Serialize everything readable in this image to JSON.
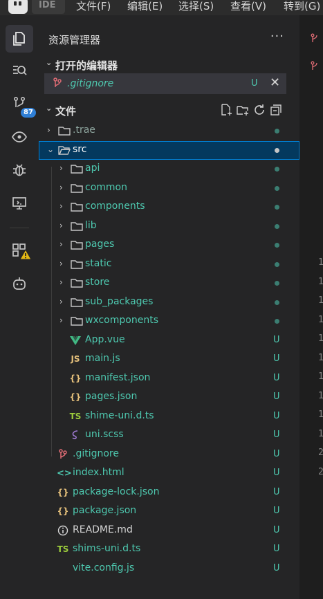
{
  "menubar": {
    "product": "IDE",
    "items": [
      "文件(F)",
      "编辑(E)",
      "选择(S)",
      "查看(V)",
      "转到(G)"
    ]
  },
  "activity_bar": {
    "items": [
      "explorer-icon",
      "search-icon",
      "source-control-icon",
      "preview-icon",
      "debug-icon",
      "remote-icon",
      "extensions-icon",
      "ai-assistant-icon"
    ],
    "source_control_badge": "87",
    "extensions_badge": "!"
  },
  "sidebar": {
    "title": "资源管理器",
    "more": "···",
    "open_editors": {
      "label": "打开的编辑器",
      "items": [
        {
          "name": ".gitignore",
          "status": "U",
          "close": "✕"
        }
      ]
    },
    "files": {
      "label": "文件"
    }
  },
  "tree": [
    {
      "name": ".trae",
      "type": "folder",
      "depth": 0,
      "expanded": false,
      "marker": "dot"
    },
    {
      "name": "src",
      "type": "folder",
      "depth": 0,
      "expanded": true,
      "marker": "dot",
      "selected": true
    },
    {
      "name": "api",
      "type": "folder",
      "depth": 1,
      "expanded": false,
      "marker": "dot"
    },
    {
      "name": "common",
      "type": "folder",
      "depth": 1,
      "expanded": false,
      "marker": "dot"
    },
    {
      "name": "components",
      "type": "folder",
      "depth": 1,
      "expanded": false,
      "marker": "dot"
    },
    {
      "name": "lib",
      "type": "folder",
      "depth": 1,
      "expanded": false,
      "marker": "dot"
    },
    {
      "name": "pages",
      "type": "folder",
      "depth": 1,
      "expanded": false,
      "marker": "dot"
    },
    {
      "name": "static",
      "type": "folder",
      "depth": 1,
      "expanded": false,
      "marker": "dot"
    },
    {
      "name": "store",
      "type": "folder",
      "depth": 1,
      "expanded": false,
      "marker": "dot"
    },
    {
      "name": "sub_packages",
      "type": "folder",
      "depth": 1,
      "expanded": false,
      "marker": "dot"
    },
    {
      "name": "wxcomponents",
      "type": "folder",
      "depth": 1,
      "expanded": false,
      "marker": "dot"
    },
    {
      "name": "App.vue",
      "type": "vue",
      "depth": 1,
      "marker": "U"
    },
    {
      "name": "main.js",
      "type": "js",
      "depth": 1,
      "marker": "U"
    },
    {
      "name": "manifest.json",
      "type": "json",
      "depth": 1,
      "marker": "U"
    },
    {
      "name": "pages.json",
      "type": "json",
      "depth": 1,
      "marker": "U"
    },
    {
      "name": "shime-uni.d.ts",
      "type": "ts",
      "depth": 1,
      "marker": "U"
    },
    {
      "name": "uni.scss",
      "type": "scss",
      "depth": 1,
      "marker": "U"
    },
    {
      "name": ".gitignore",
      "type": "git",
      "depth": 0,
      "marker": "U"
    },
    {
      "name": "index.html",
      "type": "html",
      "depth": 0,
      "marker": "U"
    },
    {
      "name": "package-lock.json",
      "type": "json",
      "depth": 0,
      "marker": "U"
    },
    {
      "name": "package.json",
      "type": "json",
      "depth": 0,
      "marker": "U"
    },
    {
      "name": "README.md",
      "type": "info",
      "depth": 0,
      "marker": "U"
    },
    {
      "name": "shims-uni.d.ts",
      "type": "ts",
      "depth": 0,
      "marker": "U"
    },
    {
      "name": "vite.config.js",
      "type": "vite",
      "depth": 0,
      "marker": "U"
    }
  ],
  "editor_gutter": [
    "1",
    "1",
    "1",
    "1",
    "1",
    "1",
    "1",
    "1",
    "1",
    "1",
    "2",
    "2"
  ],
  "colors": {
    "untracked": "#4ec9b0",
    "selection": "#04395e",
    "selection_border": "#007fd4",
    "badge": "#2f7fd6"
  }
}
